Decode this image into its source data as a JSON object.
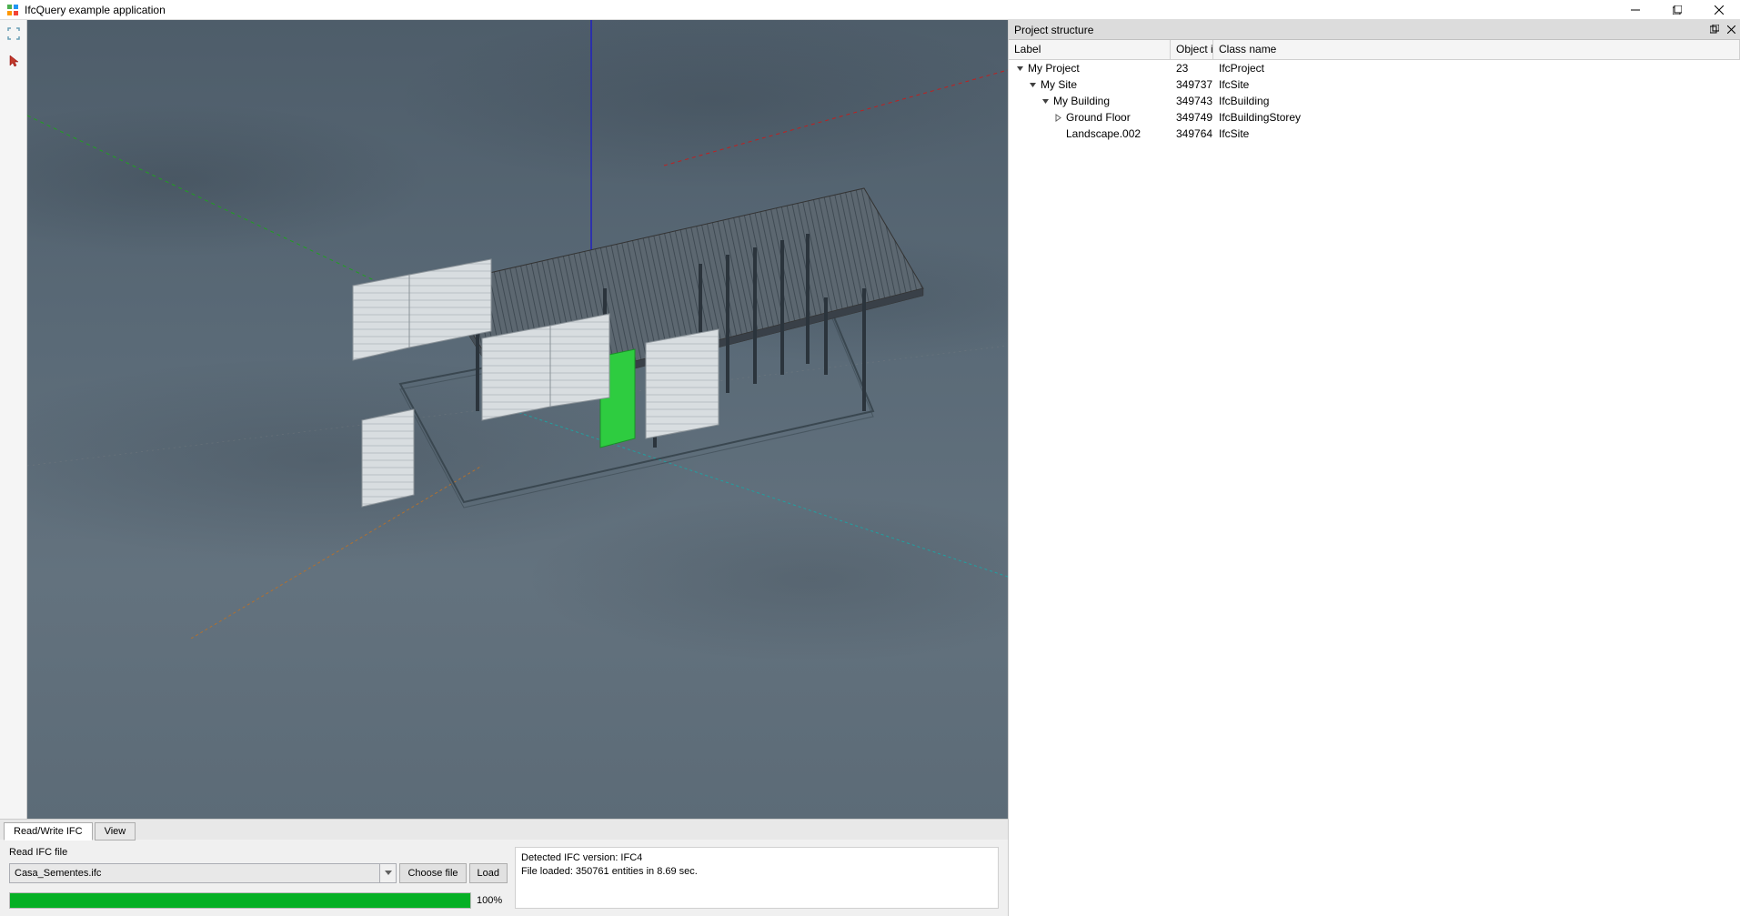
{
  "window": {
    "title": "IfcQuery example application"
  },
  "tabs": {
    "active": "Read/Write IFC",
    "inactive": "View"
  },
  "read_panel": {
    "section_label": "Read IFC file",
    "filename": "Casa_Sementes.ifc",
    "choose_label": "Choose file",
    "load_label": "Load",
    "progress_pct": "100%",
    "log_line1": "Detected IFC version: IFC4",
    "log_line2": "File loaded: 350761 entities in 8.69 sec."
  },
  "project_panel": {
    "title": "Project structure",
    "columns": {
      "label": "Label",
      "id": "Object id",
      "class": "Class name"
    },
    "rows": [
      {
        "indent": 0,
        "exp": "open",
        "label": "My Project",
        "id": "23",
        "class": "IfcProject"
      },
      {
        "indent": 1,
        "exp": "open",
        "label": "My Site",
        "id": "349737",
        "class": "IfcSite"
      },
      {
        "indent": 2,
        "exp": "open",
        "label": "My Building",
        "id": "349743",
        "class": "IfcBuilding"
      },
      {
        "indent": 3,
        "exp": "closed",
        "label": "Ground Floor",
        "id": "349749",
        "class": "IfcBuildingStorey"
      },
      {
        "indent": 3,
        "exp": "none",
        "label": "Landscape.002",
        "id": "349764",
        "class": "IfcSite"
      }
    ]
  }
}
